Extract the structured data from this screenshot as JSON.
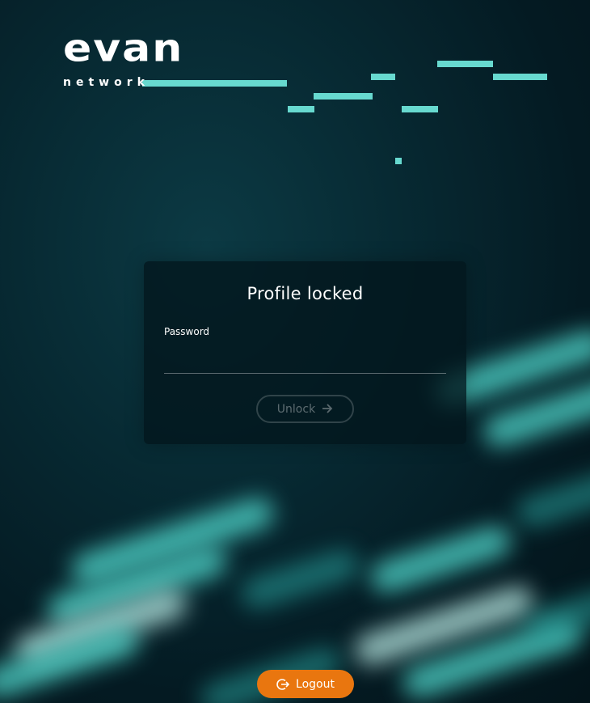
{
  "logo": {
    "word": "evan",
    "sub": "network"
  },
  "card": {
    "title": "Profile locked",
    "password_label": "Password",
    "password_value": "",
    "unlock_label": "Unlock"
  },
  "footer": {
    "logout_label": "Logout"
  },
  "colors": {
    "accent_teal": "#67d9cf",
    "logout_orange": "#e9760f",
    "background": "#041a22"
  },
  "icons": {
    "unlock": "arrow-right-icon",
    "logout": "logout-icon"
  }
}
